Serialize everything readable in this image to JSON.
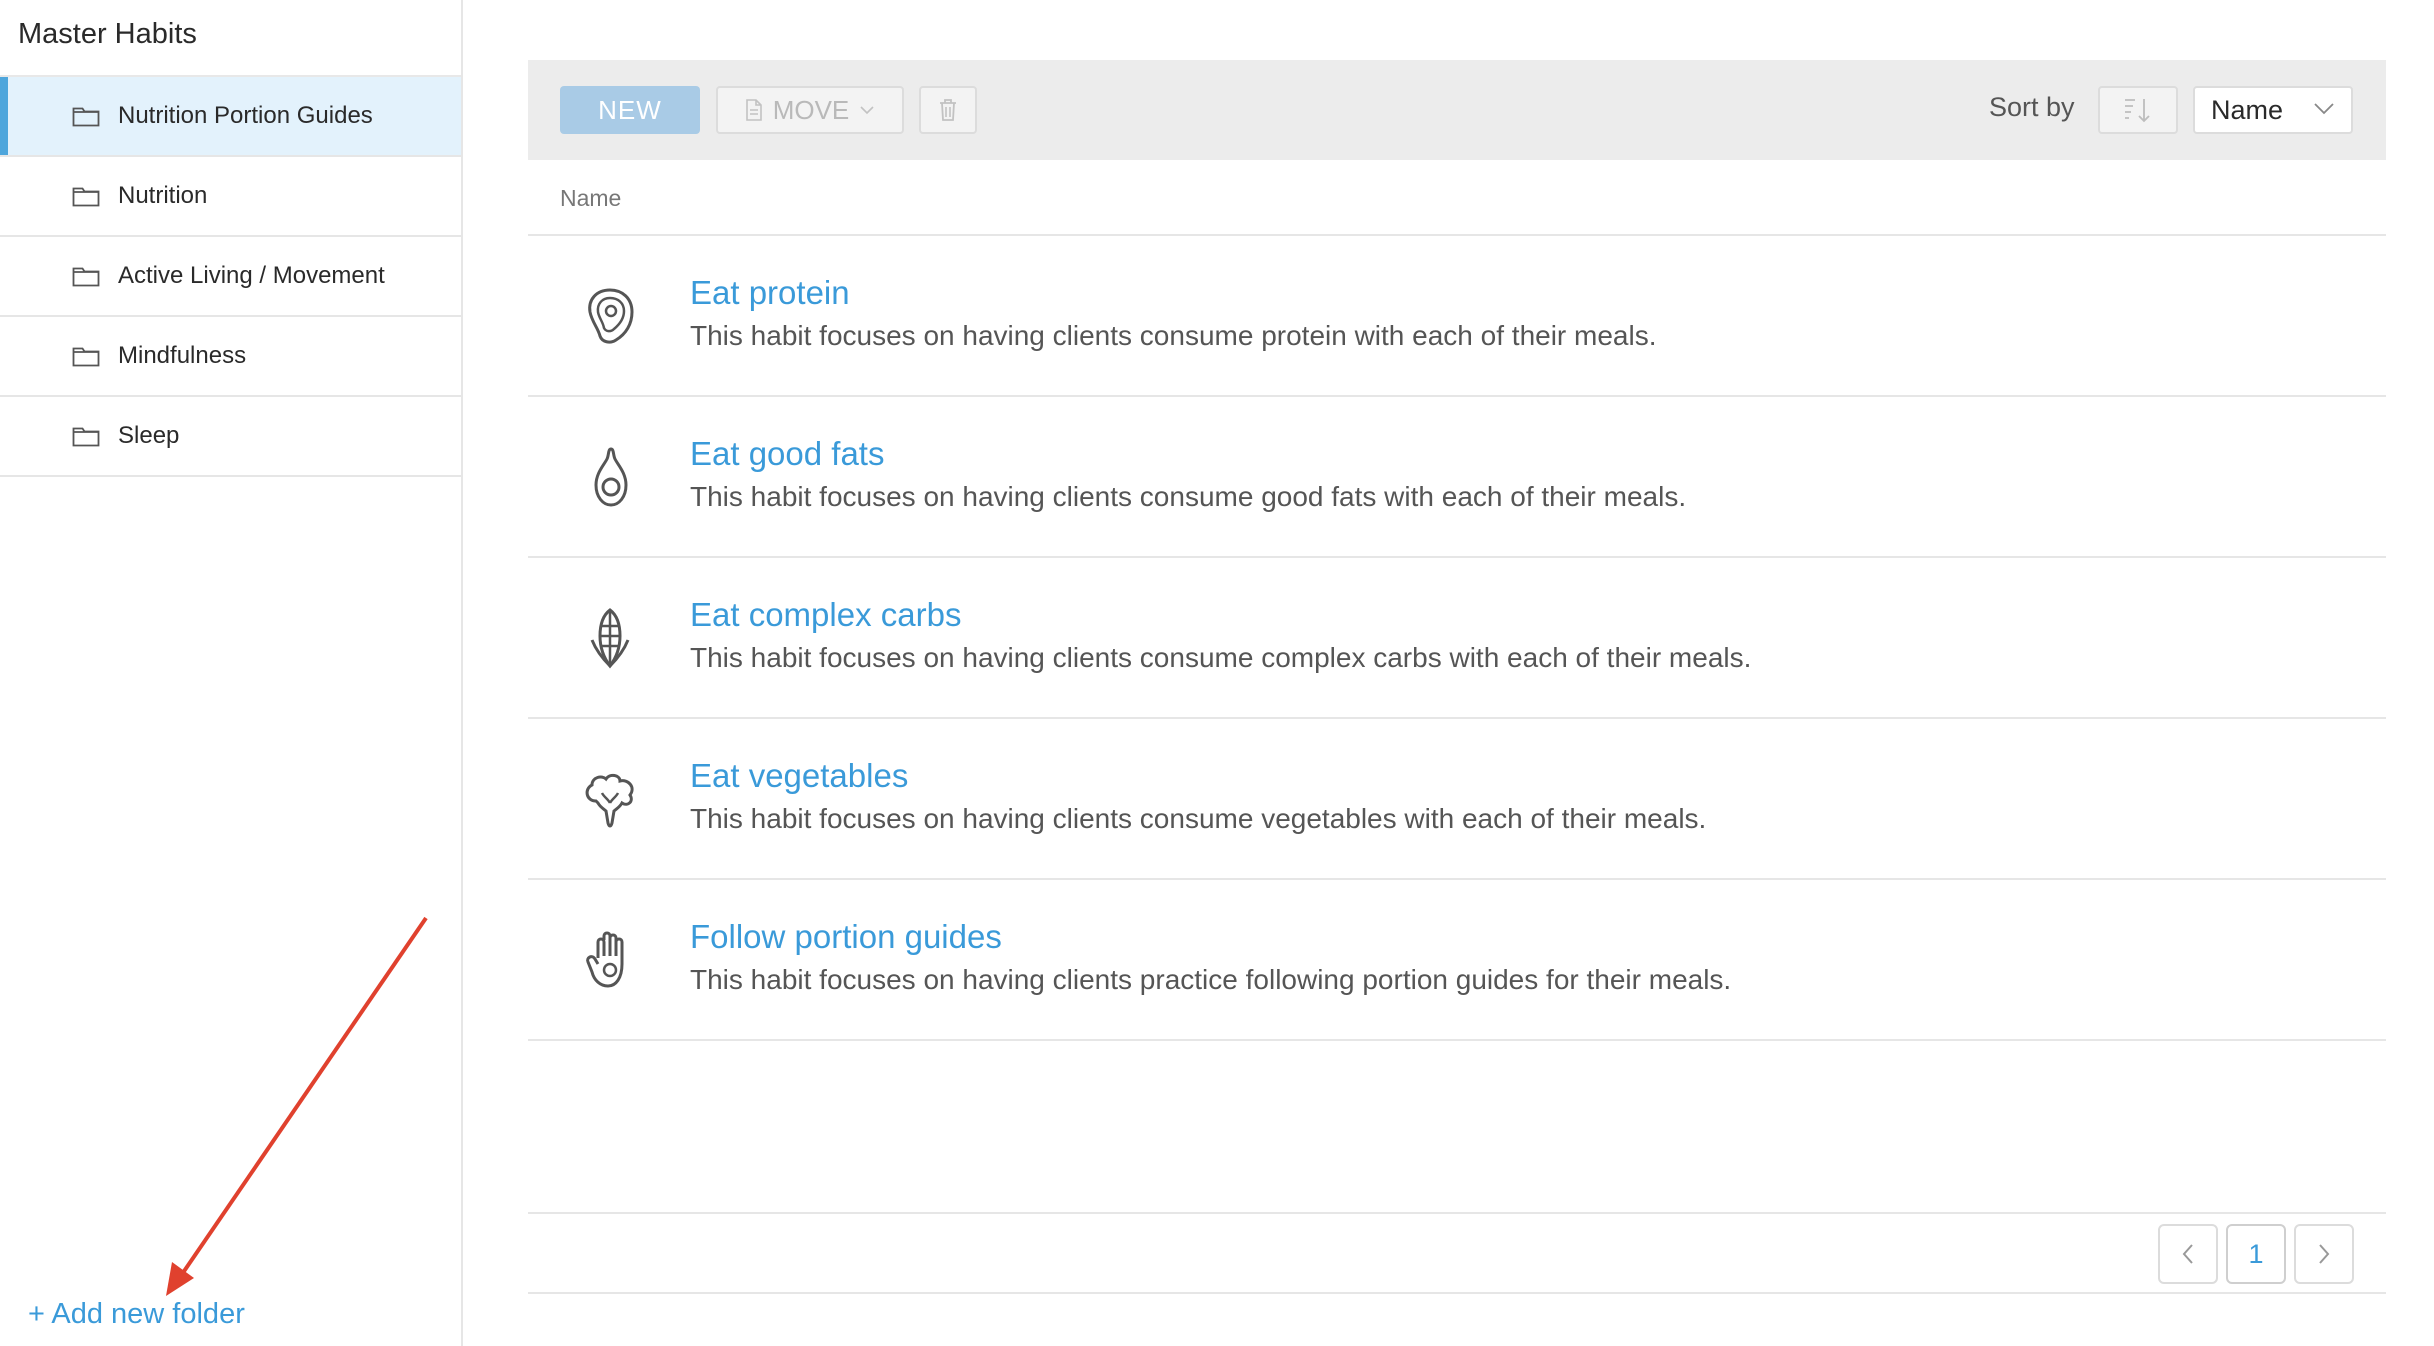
{
  "sidebar": {
    "title": "Master Habits",
    "items": [
      {
        "label": "Nutrition Portion Guides",
        "icon": "folder-icon",
        "active": true
      },
      {
        "label": "Nutrition",
        "icon": "folder-icon",
        "active": false
      },
      {
        "label": "Active Living / Movement",
        "icon": "folder-icon",
        "active": false
      },
      {
        "label": "Mindfulness",
        "icon": "folder-icon",
        "active": false
      },
      {
        "label": "Sleep",
        "icon": "folder-icon",
        "active": false
      }
    ],
    "add_folder_label": "+ Add new folder"
  },
  "toolbar": {
    "new_label": "NEW",
    "move_label": "MOVE",
    "sort_label": "Sort by",
    "sort_value": "Name"
  },
  "table": {
    "column_header": "Name",
    "rows": [
      {
        "title": "Eat protein",
        "description": "This habit focuses on having clients consume protein with each of their meals.",
        "icon": "protein-icon"
      },
      {
        "title": "Eat good fats",
        "description": "This habit focuses on having clients consume good fats with each of their meals.",
        "icon": "avocado-icon"
      },
      {
        "title": "Eat complex carbs",
        "description": "This habit focuses on having clients consume complex carbs with each of their meals.",
        "icon": "corn-icon"
      },
      {
        "title": "Eat vegetables",
        "description": "This habit focuses on having clients consume vegetables with each of their meals.",
        "icon": "broccoli-icon"
      },
      {
        "title": "Follow portion guides",
        "description": "This habit focuses on having clients practice following portion guides for their meals.",
        "icon": "hand-icon"
      }
    ]
  },
  "pagination": {
    "current_page": "1"
  },
  "colors": {
    "accent": "#3a9ad9",
    "active_bg": "#e3f2fc",
    "annotation_arrow": "#e0412e"
  }
}
